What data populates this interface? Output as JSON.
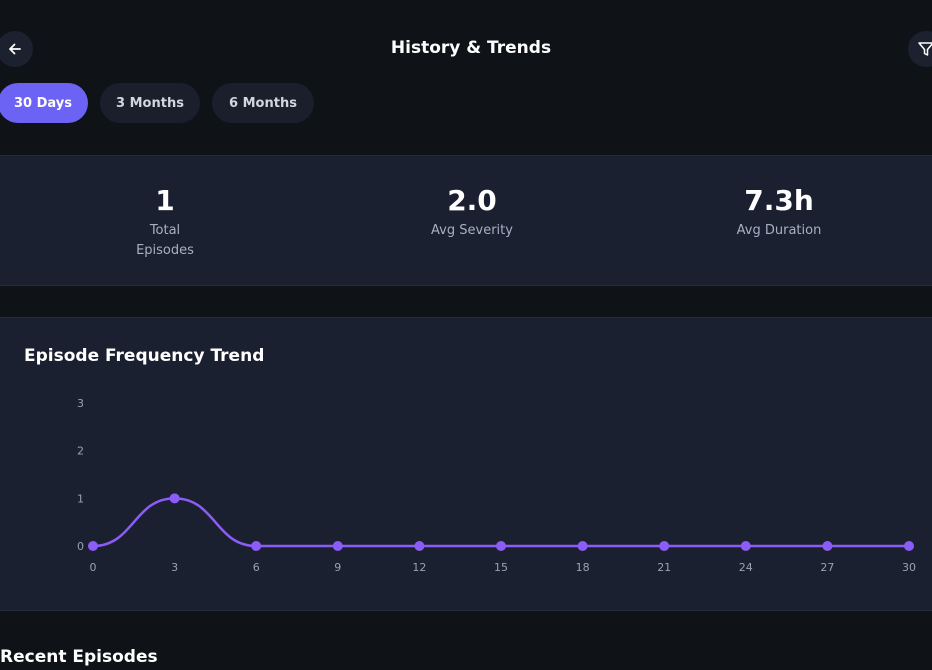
{
  "header": {
    "title": "History & Trends",
    "back_icon": "arrow-left-icon",
    "filter_icon": "filter-icon"
  },
  "range_tabs": [
    {
      "label": "30 Days",
      "active": true
    },
    {
      "label": "3 Months",
      "active": false
    },
    {
      "label": "6 Months",
      "active": false
    }
  ],
  "stats": [
    {
      "value": "1",
      "label": "Total Episodes"
    },
    {
      "value": "2.0",
      "label": "Avg Severity"
    },
    {
      "value": "7.3h",
      "label": "Avg Duration"
    }
  ],
  "chart_data": {
    "type": "line",
    "title": "Episode Frequency Trend",
    "x": [
      0,
      3,
      6,
      9,
      12,
      15,
      18,
      21,
      24,
      27,
      30
    ],
    "series": [
      {
        "values": [
          0,
          1,
          0,
          0,
          0,
          0,
          0,
          0,
          0,
          0,
          0
        ]
      }
    ],
    "xlim": [
      0,
      30
    ],
    "ylim": [
      0,
      3
    ],
    "yticks": [
      0,
      1,
      2,
      3
    ],
    "xlabel": "",
    "ylabel": "",
    "grid": false,
    "line_color": "#8b5cf6",
    "smooth": true
  },
  "recent": {
    "title": "Recent Episodes"
  },
  "colors": {
    "background": "#0f1318",
    "card": "#1b2030",
    "accent": "#6c63f5",
    "line": "#8b5cf6"
  }
}
